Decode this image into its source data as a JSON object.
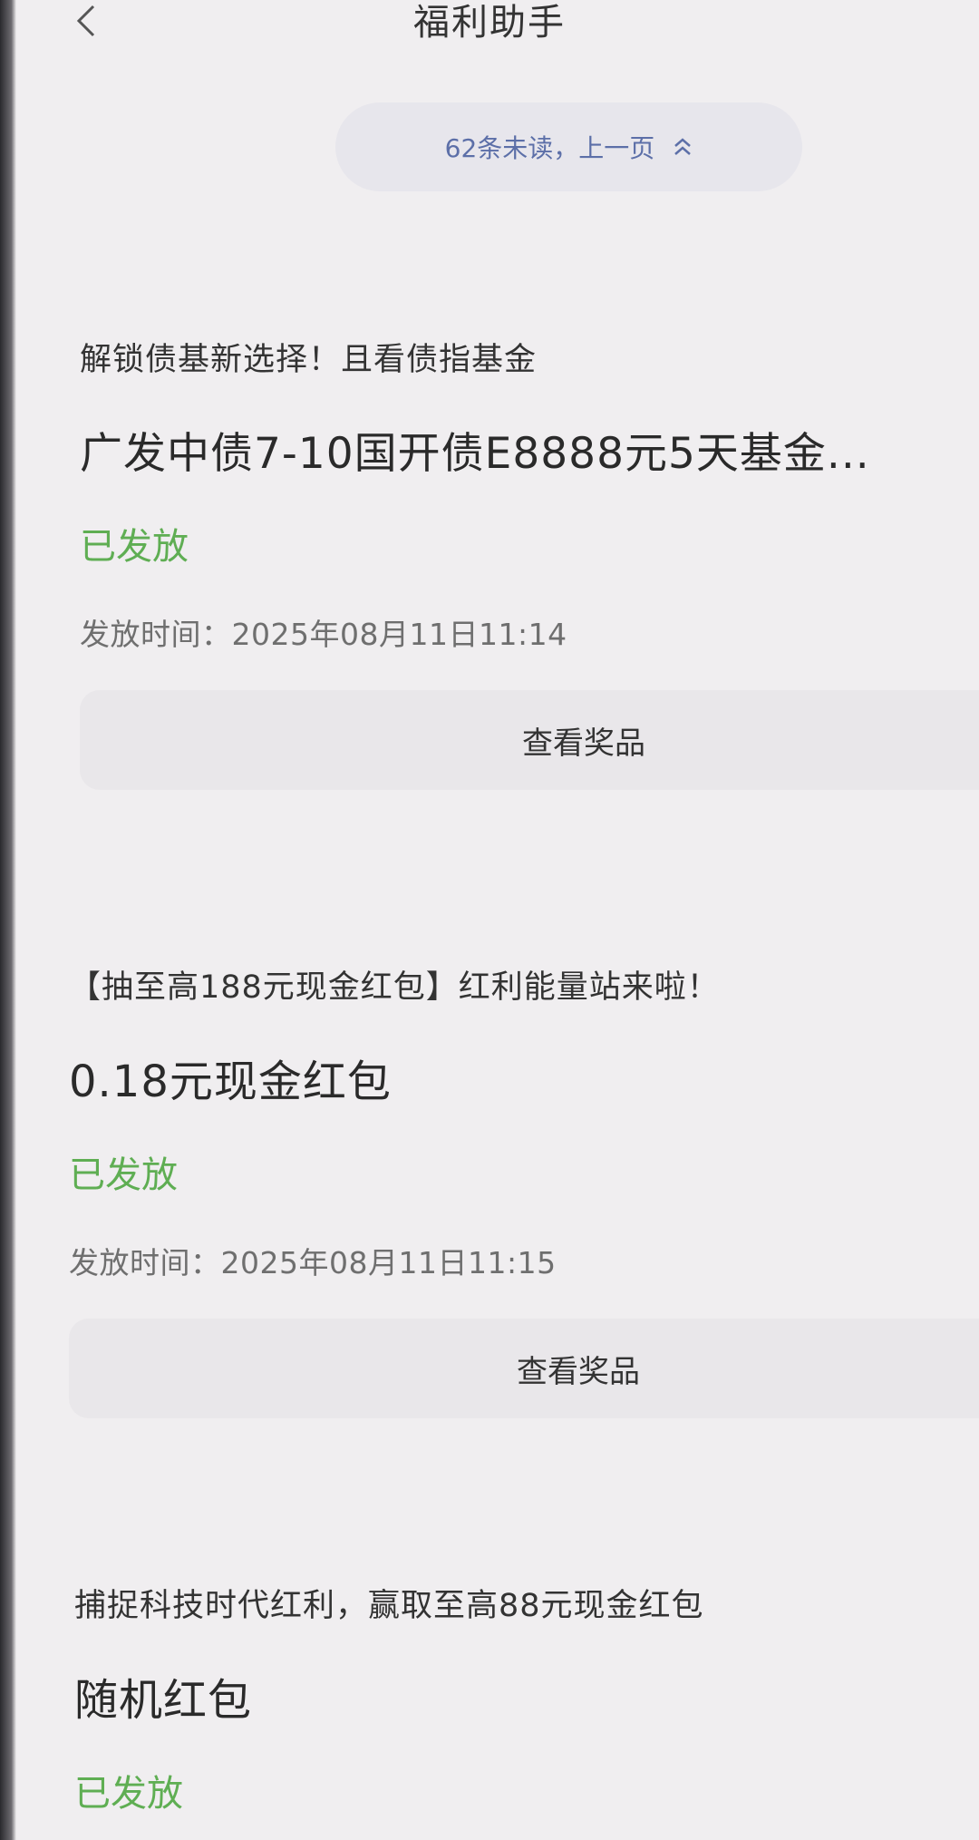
{
  "header": {
    "title": "福利助手"
  },
  "unread": {
    "label": "62条未读，上一页"
  },
  "cards": [
    {
      "subtitle": "解锁债基新选择！且看债指基金",
      "title": "广发中债7-10国开债E8888元5天基金...",
      "status": "已发放",
      "time": "发放时间：2025年08月11日11:14",
      "button": "查看奖品"
    },
    {
      "subtitle": "【抽至高188元现金红包】红利能量站来啦！",
      "title": "0.18元现金红包",
      "status": "已发放",
      "time": "发放时间：2025年08月11日11:15",
      "button": "查看奖品"
    },
    {
      "subtitle": "捕捉科技时代红利，赢取至高88元现金红包",
      "title": "随机红包",
      "status": "已发放"
    }
  ]
}
